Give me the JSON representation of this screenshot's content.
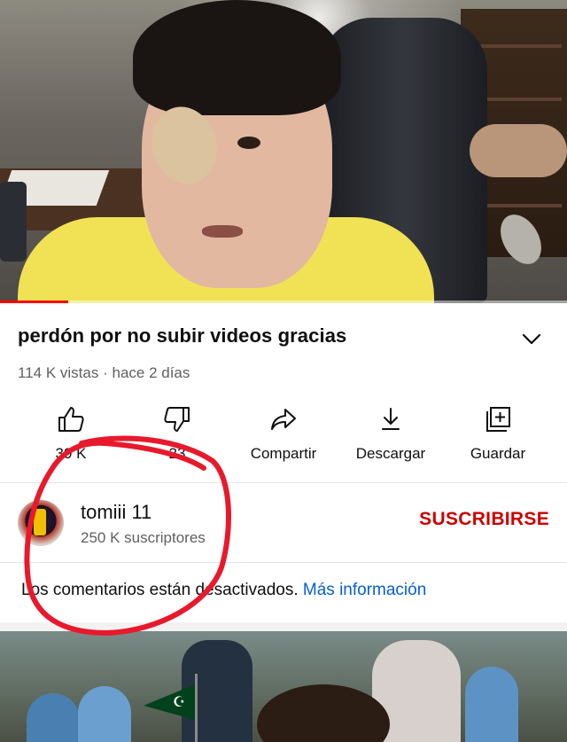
{
  "video": {
    "title": "perdón por no subir videos gracias",
    "views": "114 K vistas",
    "separator": "·",
    "age": "hace 2 días",
    "progress_fraction": 0.12
  },
  "actions": [
    {
      "label": "39 K",
      "icon": "thumbs-up-icon"
    },
    {
      "label": "23",
      "icon": "thumbs-down-icon"
    },
    {
      "label": "Compartir",
      "icon": "share-icon"
    },
    {
      "label": "Descargar",
      "icon": "download-icon"
    },
    {
      "label": "Guardar",
      "icon": "save-playlist-icon"
    }
  ],
  "channel": {
    "name": "tomiii 11",
    "subscribers": "250 K suscriptores",
    "subscribe_label": "SUSCRIBIRSE"
  },
  "comments": {
    "disabled_text": "Los comentarios están desactivados.",
    "more_link": "Más información"
  },
  "colors": {
    "accent_red": "#cc0000",
    "link_blue": "#065fd4",
    "annotation_red": "#e8192c"
  }
}
